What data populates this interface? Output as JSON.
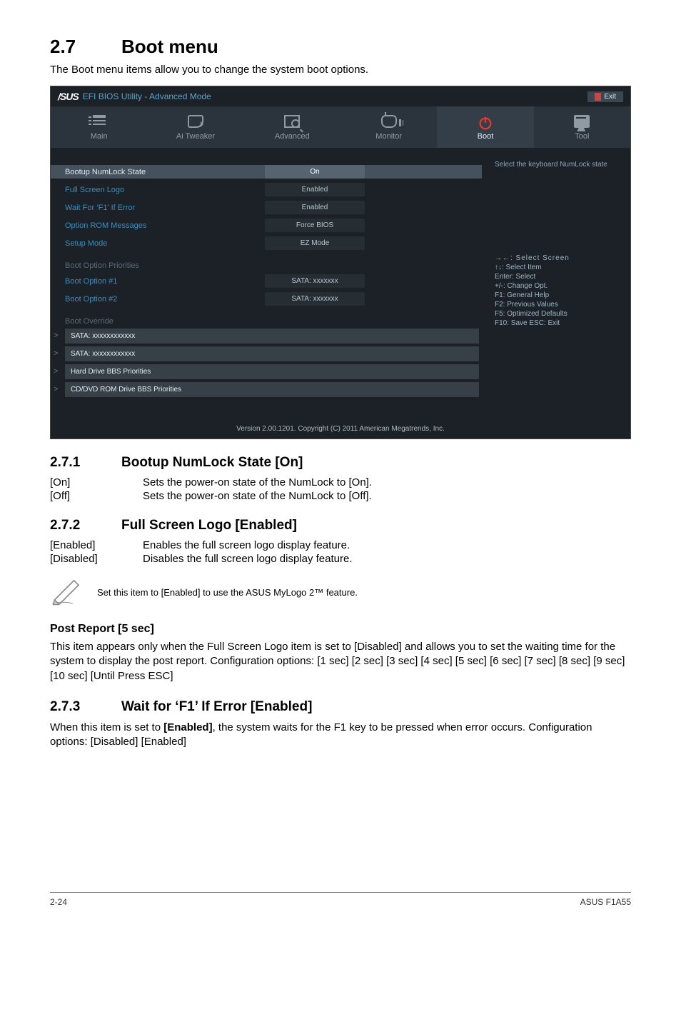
{
  "page": {
    "section_no": "2.7",
    "section_title": "Boot menu",
    "intro": "The Boot menu items allow you to change the system boot options."
  },
  "bios": {
    "brand": "/SUS",
    "title": "EFI BIOS Utility - Advanced Mode",
    "exit": "Exit",
    "tabs": {
      "main": "Main",
      "tweaker": "Ai  Tweaker",
      "advanced": "Advanced",
      "monitor": "Monitor",
      "boot": "Boot",
      "tool": "Tool"
    },
    "rows": {
      "numlock_lbl": "Bootup NumLock State",
      "numlock_val": "On",
      "logo_lbl": "Full Screen Logo",
      "logo_val": "Enabled",
      "wait_lbl": "Wait For ‘F1’ If Error",
      "wait_val": "Enabled",
      "oprom_lbl": "Option ROM Messages",
      "oprom_val": "Force BIOS",
      "setup_lbl": "Setup Mode",
      "setup_val": "EZ Mode"
    },
    "boot_pri_head": "Boot Option Priorities",
    "bo1_lbl": "Boot Option #1",
    "bo1_val": "SATA: xxxxxxx",
    "bo2_lbl": "Boot Option #2",
    "bo2_val": "SATA: xxxxxxx",
    "override_head": "Boot Override",
    "nav1": "SATA: xxxxxxxxxxxx",
    "nav2": "SATA: xxxxxxxxxxxx",
    "nav3": "Hard Drive BBS Priorities",
    "nav4": "CD/DVD ROM Drive BBS Priorities",
    "help": "Select the keyboard NumLock state",
    "keys": {
      "k1": "→←:  Select Screen",
      "k2": "↑↓:  Select Item",
      "k3": "Enter:  Select",
      "k4": "+/-:  Change Opt.",
      "k5": "F1:  General Help",
      "k6": "F2:  Previous Values",
      "k7": "F5:  Optimized Defaults",
      "k8": "F10:  Save   ESC:  Exit"
    },
    "footer": "Version  2.00.1201.   Copyright  (C)  2011 American  Megatrends,  Inc."
  },
  "s271": {
    "no": "2.7.1",
    "title": "Bootup NumLock State [On]",
    "on_k": "[On]",
    "on_v": "Sets the power-on state of the NumLock to [On].",
    "off_k": "[Off]",
    "off_v": "Sets the power-on state of the NumLock to [Off]."
  },
  "s272": {
    "no": "2.7.2",
    "title": "Full Screen Logo [Enabled]",
    "en_k": "[Enabled]",
    "en_v": "Enables the full screen logo display feature.",
    "di_k": "[Disabled]",
    "di_v": "Disables the full screen logo display feature.",
    "note": "Set this item to [Enabled] to use the ASUS MyLogo 2™ feature."
  },
  "post": {
    "title": "Post Report [5 sec]",
    "body": "This item appears only when the Full Screen Logo item is set to [Disabled] and allows you to set the waiting time for the system to display the post report. Configuration options: [1 sec] [2 sec] [3 sec] [4 sec] [5 sec] [6 sec] [7 sec] [8 sec] [9 sec] [10 sec] [Until Press ESC]"
  },
  "s273": {
    "no": "2.7.3",
    "title": "Wait for ‘F1’ If Error [Enabled]",
    "body_pre": "When this item is set to ",
    "body_bold": "[Enabled]",
    "body_post": ", the system waits for the F1 key to be pressed when error occurs. Configuration options: [Disabled] [Enabled]"
  },
  "footer": {
    "left": "2-24",
    "right": "ASUS F1A55"
  }
}
